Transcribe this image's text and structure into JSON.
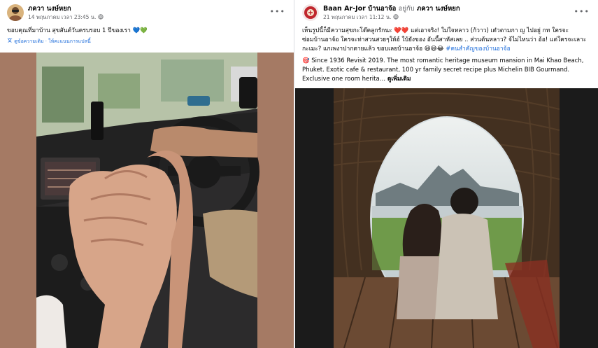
{
  "left_post": {
    "author": "ภควา นงษ์หยก",
    "timestamp": "14 พฤษภาคม เวลา 23:45 น.",
    "privacy_icon": "globe-icon",
    "more_icon": "more-options-icon",
    "text": "ขอบคุณที่มาบ้าน สุขสันต์วันครบรอบ 1 ปีของเรา",
    "emojis": "💙💚",
    "see_original": "ดูข้อความเดิม · ให้คะแนนการแปลนี้",
    "photo_icon": "holding-hands-photo"
  },
  "right_post": {
    "author": "Baan Ar-Jor บ้านอาจ้อ",
    "with_label": "อยู่กับ",
    "tagged": "ภควา นงษ์หยก",
    "timestamp": "21 พฤษภาคม เวลา 11:12 น.",
    "privacy_icon": "globe-icon",
    "more_icon": "more-options-icon",
    "text_line1": "เห็นรูปนี้ก็มีความสุขกะโด๊คลูกรักนะ ❤️❤️ แต่เอาจริง! ใม่ใจหลาว (ก้วาว) เด๋วตามกา ญ ไปอยู่ กท ใครจะ",
    "text_line2": "ซ่อมบ้านอาจ้อ ใครจะท่าสวนสวยๆให้ฮ์ ใบ้ยังของ อันนี้สาหัสเลย .. ส่วนต้นหลาว? จ้ไม่ไหนว่า อ้อ! แต่ใครจะเลาะกะเมะ? แกเพงาปากตายแล้ว ขอบเลยบ้านอาจ้อ 😆😅😂",
    "hashtag": "#คนสำคัญของบ้านอาจ้อ",
    "text_english": "🎯 Since 1936 Revisit 2019. The most romantic heritage museum mansion in Mai Khao Beach, Phuket. Exotic cafe & restaurant, 100 yr family secret recipe plus Michelin BIB Gourmand. Exclusive one room herita…",
    "see_more": "ดูเพิ่มเติม",
    "photo_icon": "couple-in-nest-photo"
  },
  "colors": {
    "link": "#216fdb",
    "text": "#050505",
    "muted": "#65676b",
    "left_bg": "#a57a64",
    "right_bg": "#1b1b1b"
  }
}
